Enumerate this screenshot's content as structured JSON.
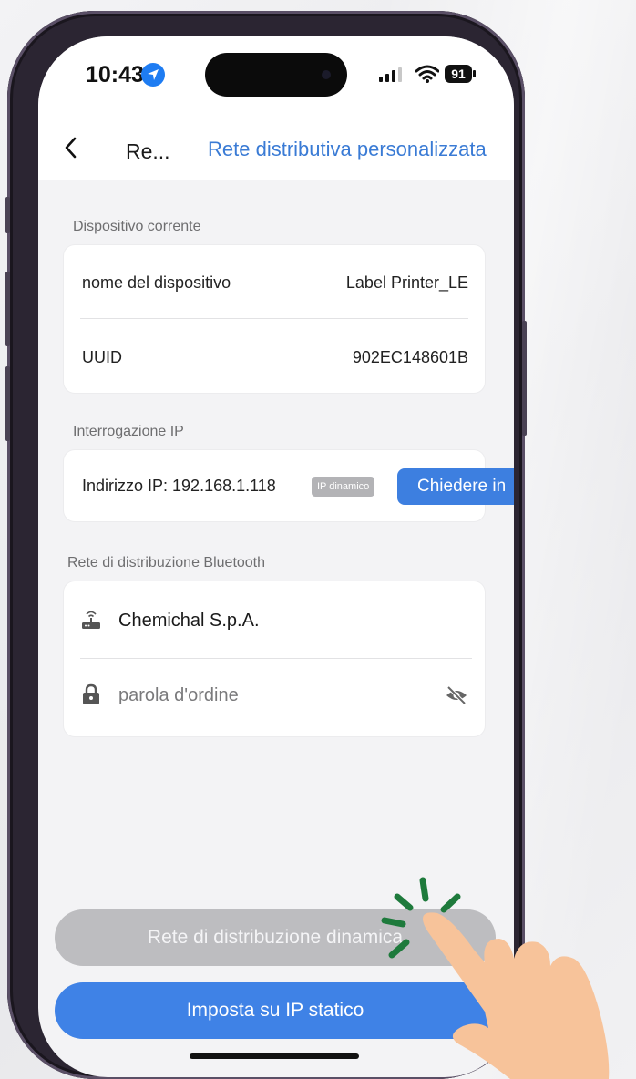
{
  "status_bar": {
    "time": "10:43",
    "battery": "91"
  },
  "navbar": {
    "title": "Re...",
    "action_label": "Rete distributiva personalizzata"
  },
  "current_device": {
    "section_label": "Dispositivo corrente",
    "rows": [
      {
        "label": "nome del dispositivo",
        "value": "Label Printer_LE"
      },
      {
        "label": "UUID",
        "value": "902EC148601B"
      }
    ]
  },
  "ip_query": {
    "section_label": "Interrogazione IP",
    "ip_label": "Indirizzo IP: 192.168.1.118",
    "badge": "IP dinamico",
    "query_button": "Chiedere in"
  },
  "bluetooth": {
    "section_label": "Rete di distribuzione Bluetooth",
    "network_value": "Chemichal S.p.A.",
    "password_placeholder": "parola d'ordine"
  },
  "buttons": {
    "dynamic": "Rete di distribuzione dinamica",
    "static": "Imposta su IP statico"
  },
  "icons": [
    "location-arrow-icon",
    "signal-icon",
    "wifi-icon",
    "battery-icon",
    "back-icon",
    "router-icon",
    "lock-icon",
    "eye-off-icon",
    "pointing-hand-icon"
  ],
  "colors": {
    "accent": "#3d7fe0",
    "disabled": "#bdbdc0",
    "hand": "#f7c39a",
    "spark": "#1e7a3c"
  }
}
